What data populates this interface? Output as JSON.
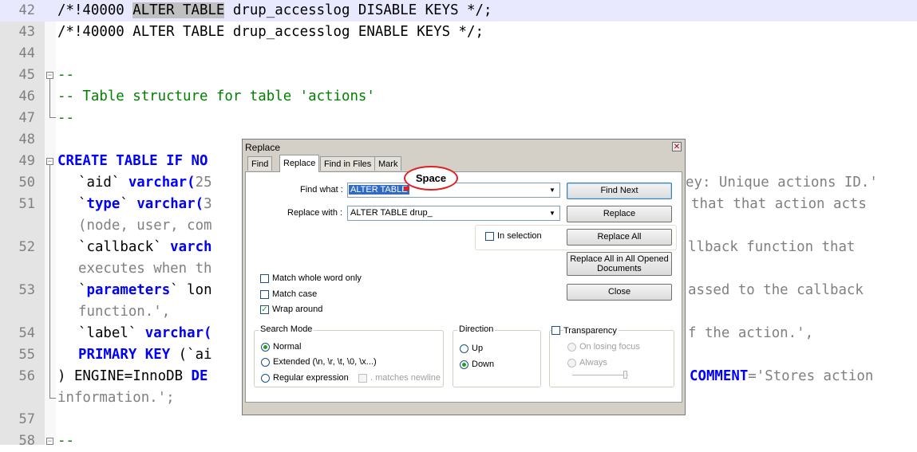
{
  "editor": {
    "lines": [
      {
        "num": "42",
        "segments": [
          "/*!40000 ",
          "ALTER TABLE",
          " drup_accesslog DISABLE KEYS */;"
        ]
      },
      {
        "num": "43",
        "text": "/*!40000 ALTER TABLE drup_accesslog ENABLE KEYS */;"
      },
      {
        "num": "44",
        "text": ""
      },
      {
        "num": "45",
        "text": "--"
      },
      {
        "num": "46",
        "text": "-- Table structure for table 'actions'"
      },
      {
        "num": "47",
        "text": "--"
      },
      {
        "num": "48",
        "text": ""
      },
      {
        "num": "49",
        "kw": "CREATE TABLE IF NO"
      },
      {
        "num": "50",
        "a": "`aid` ",
        "kw": "varchar(",
        "s": "25",
        "right": "ey: Unique actions ID.'"
      },
      {
        "num": "51",
        "a": "`",
        "kw": "type",
        "b": "` ",
        "kw2": "varchar(",
        "s": "3",
        "right": "that that action acts"
      },
      {
        "num": "",
        "text": "(node, user, com"
      },
      {
        "num": "52",
        "a": "`callback` ",
        "kw": "varch",
        "right": "llback function that"
      },
      {
        "num": "",
        "text": "executes when th"
      },
      {
        "num": "53",
        "a": "`",
        "kw": "parameters",
        "b": "` lon",
        "right": "assed to the callback"
      },
      {
        "num": "",
        "text": "function.',"
      },
      {
        "num": "54",
        "a": "`label` ",
        "kw": "varchar(",
        "right": "f the action.',"
      },
      {
        "num": "55",
        "kw": "PRIMARY KEY",
        "b": " (`ai"
      },
      {
        "num": "56",
        "a": ") ENGINE=InnoDB ",
        "kw": "DE",
        "right_kw": "COMMENT",
        "right": "='Stores action"
      },
      {
        "num": "",
        "text": "information.';"
      },
      {
        "num": "57",
        "text": ""
      },
      {
        "num": "58",
        "text": "--"
      }
    ]
  },
  "dialog": {
    "title": "Replace",
    "close": "✕",
    "tabs": [
      "Find",
      "Replace",
      "Find in Files",
      "Mark"
    ],
    "find_label": "Find what :",
    "find_value": "ALTER TABLE",
    "replace_label": "Replace with :",
    "replace_value": "ALTER TABLE drup_",
    "in_selection": "In selection",
    "buttons": {
      "find_next": "Find Next",
      "replace": "Replace",
      "replace_all": "Replace All",
      "replace_all_open": "Replace All in All Opened Documents",
      "close": "Close"
    },
    "options": {
      "match_whole_word": "Match whole word only",
      "match_case": "Match case",
      "wrap_around": "Wrap around",
      "wrap_checked": true
    },
    "search_mode": {
      "title": "Search Mode",
      "normal": "Normal",
      "extended": "Extended (\\n, \\r, \\t, \\0, \\x...)",
      "regex": "Regular expression",
      "matches_newline": ". matches newline",
      "selected": "normal"
    },
    "direction": {
      "title": "Direction",
      "up": "Up",
      "down": "Down",
      "selected": "down"
    },
    "transparency": {
      "title": "Transparency",
      "on_losing_focus": "On losing focus",
      "always": "Always"
    }
  },
  "annotation": {
    "label": "Space",
    "color": "#e02020"
  }
}
